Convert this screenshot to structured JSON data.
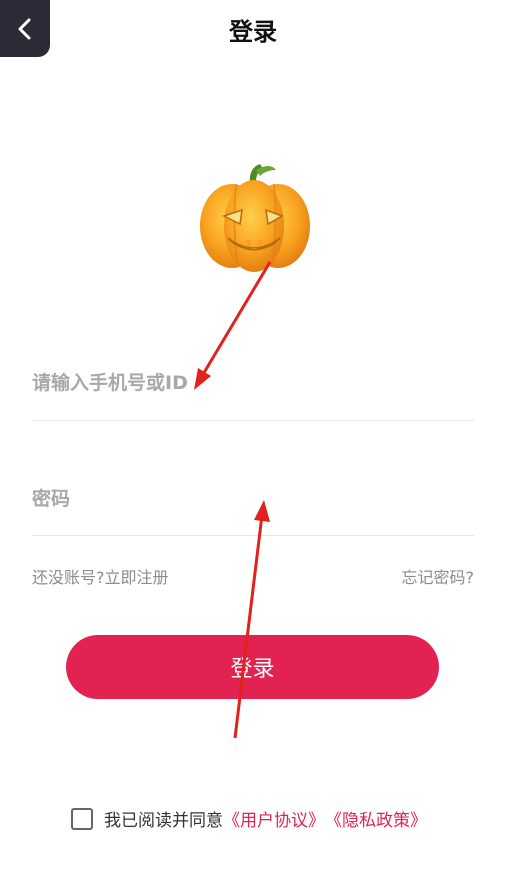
{
  "header": {
    "title": "登录",
    "back_icon": "chevron-left-icon"
  },
  "logo": {
    "icon": "pumpkin-logo-icon"
  },
  "form": {
    "phone_placeholder": "请输入手机号或ID",
    "password_placeholder": "密码",
    "register_link": "还没账号?立即注册",
    "forgot_link": "忘记密码?",
    "login_label": "登录"
  },
  "agreement": {
    "text": "我已阅读并同意",
    "user_agreement": "《用户协议》",
    "privacy_policy": "《隐私政策》",
    "checked": false
  },
  "colors": {
    "accent": "#e22352",
    "back_button_bg": "#2b2b38",
    "annotation_arrow": "#e3211c"
  }
}
